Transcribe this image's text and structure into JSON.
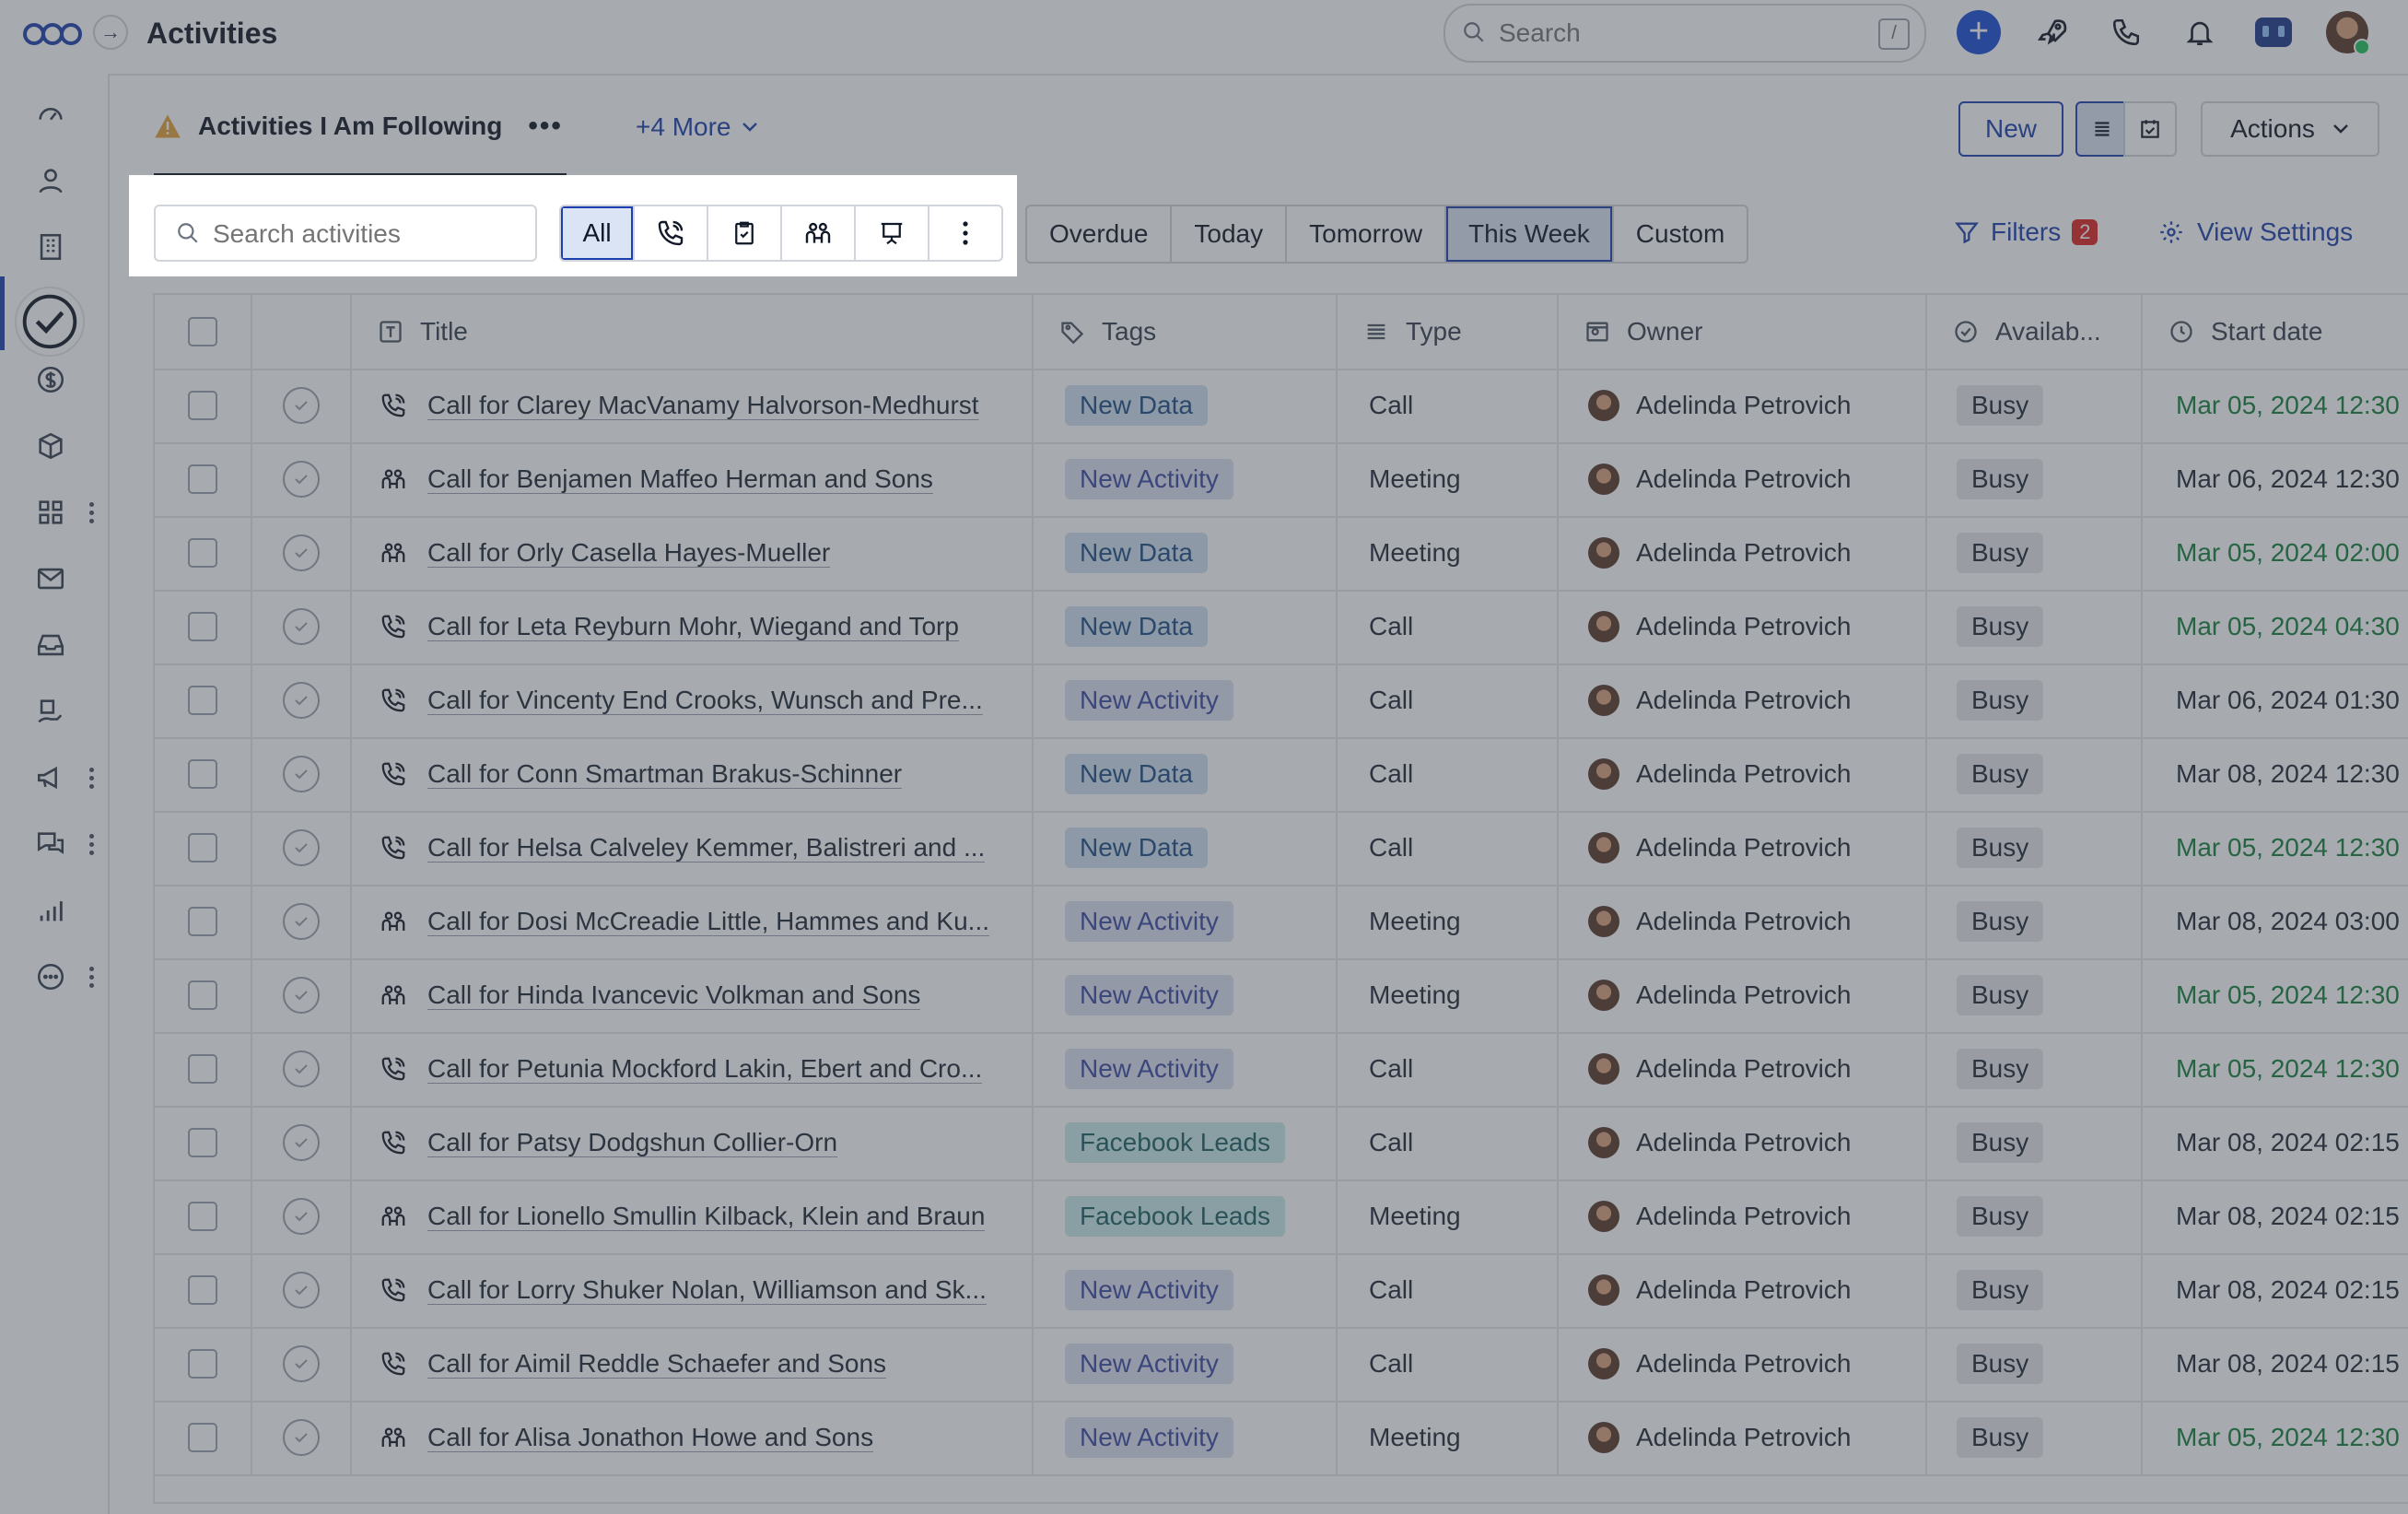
{
  "app": {
    "title": "Activities",
    "expand_icon": "→",
    "search_placeholder": "Search",
    "search_shortcut": "/"
  },
  "view": {
    "current": "Activities I Am Following",
    "more_views": "+4 More",
    "new_label": "New",
    "actions_label": "Actions"
  },
  "filters": {
    "search_placeholder": "Search activities",
    "type_all_label": "All",
    "date_ranges": [
      "Overdue",
      "Today",
      "Tomorrow",
      "This Week",
      "Custom"
    ],
    "selected_range": "This Week",
    "filters_label": "Filters",
    "filters_count": "2",
    "view_settings_label": "View Settings"
  },
  "table": {
    "columns": [
      "Title",
      "Tags",
      "Type",
      "Owner",
      "Availab...",
      "Start date"
    ],
    "rows": [
      {
        "icon": "phone",
        "title": "Call for Clarey MacVanamy Halvorson-Medhurst",
        "tag": "New Data",
        "type": "Call",
        "owner": "Adelinda Petrovich",
        "availability": "Busy",
        "start": "Mar 05, 2024 12:30",
        "start_color": "green"
      },
      {
        "icon": "meeting",
        "title": "Call for Benjamen Maffeo Herman and Sons",
        "tag": "New Activity",
        "type": "Meeting",
        "owner": "Adelinda Petrovich",
        "availability": "Busy",
        "start": "Mar 06, 2024 12:30",
        "start_color": "default"
      },
      {
        "icon": "meeting",
        "title": "Call for Orly Casella Hayes-Mueller",
        "tag": "New Data",
        "type": "Meeting",
        "owner": "Adelinda Petrovich",
        "availability": "Busy",
        "start": "Mar 05, 2024 02:00",
        "start_color": "green"
      },
      {
        "icon": "phone",
        "title": "Call for Leta Reyburn Mohr, Wiegand and Torp",
        "tag": "New Data",
        "type": "Call",
        "owner": "Adelinda Petrovich",
        "availability": "Busy",
        "start": "Mar 05, 2024 04:30",
        "start_color": "green"
      },
      {
        "icon": "phone",
        "title": "Call for Vincenty End Crooks, Wunsch and Pre...",
        "tag": "New Activity",
        "type": "Call",
        "owner": "Adelinda Petrovich",
        "availability": "Busy",
        "start": "Mar 06, 2024 01:30",
        "start_color": "default"
      },
      {
        "icon": "phone",
        "title": "Call for Conn Smartman Brakus-Schinner",
        "tag": "New Data",
        "type": "Call",
        "owner": "Adelinda Petrovich",
        "availability": "Busy",
        "start": "Mar 08, 2024 12:30",
        "start_color": "default"
      },
      {
        "icon": "phone",
        "title": "Call for Helsa Calveley Kemmer, Balistreri and ...",
        "tag": "New Data",
        "type": "Call",
        "owner": "Adelinda Petrovich",
        "availability": "Busy",
        "start": "Mar 05, 2024 12:30",
        "start_color": "green"
      },
      {
        "icon": "meeting",
        "title": "Call for Dosi McCreadie Little, Hammes and Ku...",
        "tag": "New Activity",
        "type": "Meeting",
        "owner": "Adelinda Petrovich",
        "availability": "Busy",
        "start": "Mar 08, 2024 03:00",
        "start_color": "default"
      },
      {
        "icon": "meeting",
        "title": "Call for Hinda Ivancevic Volkman and Sons",
        "tag": "New Activity",
        "type": "Meeting",
        "owner": "Adelinda Petrovich",
        "availability": "Busy",
        "start": "Mar 05, 2024 12:30",
        "start_color": "green"
      },
      {
        "icon": "phone",
        "title": "Call for Petunia Mockford Lakin, Ebert and Cro...",
        "tag": "New Activity",
        "type": "Call",
        "owner": "Adelinda Petrovich",
        "availability": "Busy",
        "start": "Mar 05, 2024 12:30",
        "start_color": "green"
      },
      {
        "icon": "phone",
        "title": "Call for Patsy Dodgshun Collier-Orn",
        "tag": "Facebook Leads",
        "type": "Call",
        "owner": "Adelinda Petrovich",
        "availability": "Busy",
        "start": "Mar 08, 2024 02:15",
        "start_color": "default"
      },
      {
        "icon": "meeting",
        "title": "Call for Lionello Smullin Kilback, Klein and Braun",
        "tag": "Facebook Leads",
        "type": "Meeting",
        "owner": "Adelinda Petrovich",
        "availability": "Busy",
        "start": "Mar 08, 2024 02:15",
        "start_color": "default"
      },
      {
        "icon": "phone",
        "title": "Call for Lorry Shuker Nolan, Williamson and Sk...",
        "tag": "New Activity",
        "type": "Call",
        "owner": "Adelinda Petrovich",
        "availability": "Busy",
        "start": "Mar 08, 2024 02:15",
        "start_color": "default"
      },
      {
        "icon": "phone",
        "title": "Call for Aimil Reddle Schaefer and Sons",
        "tag": "New Activity",
        "type": "Call",
        "owner": "Adelinda Petrovich",
        "availability": "Busy",
        "start": "Mar 08, 2024 02:15",
        "start_color": "default"
      },
      {
        "icon": "meeting",
        "title": "Call for Alisa Jonathon Howe and Sons",
        "tag": "New Activity",
        "type": "Meeting",
        "owner": "Adelinda Petrovich",
        "availability": "Busy",
        "start": "Mar 05, 2024 12:30",
        "start_color": "green"
      }
    ]
  },
  "colors": {
    "accent": "#1e40af",
    "overlay": "#4b5563",
    "green_date": "#15803d",
    "badge_red": "#dc2626"
  }
}
